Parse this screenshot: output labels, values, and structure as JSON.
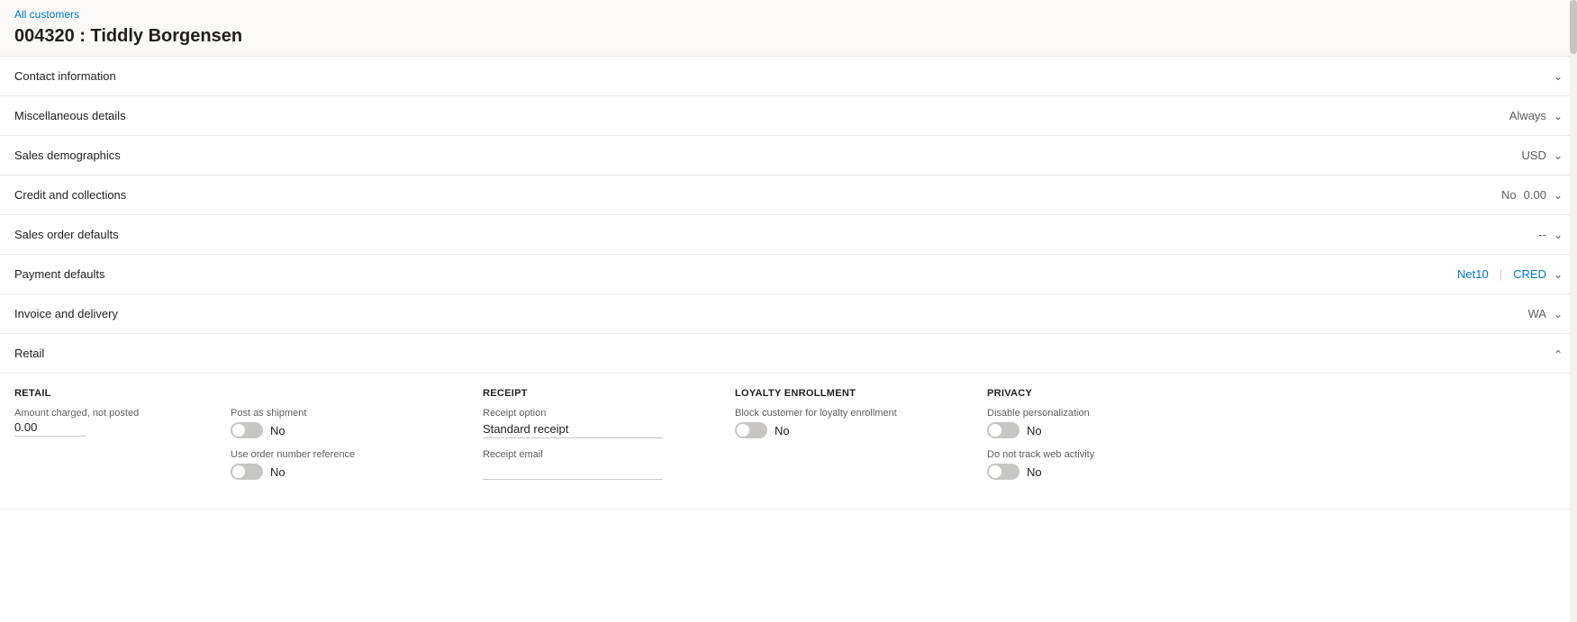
{
  "breadcrumb": {
    "label": "All customers",
    "link_text": "All customers"
  },
  "page": {
    "title": "004320 : Tiddly Borgensen"
  },
  "sections": [
    {
      "id": "contact-information",
      "label": "Contact information",
      "meta": "",
      "expanded": false,
      "chevron": "down"
    },
    {
      "id": "miscellaneous-details",
      "label": "Miscellaneous details",
      "meta": "Always",
      "meta_color": "normal",
      "expanded": false,
      "chevron": "down"
    },
    {
      "id": "sales-demographics",
      "label": "Sales demographics",
      "meta": "USD",
      "meta_color": "blue",
      "expanded": false,
      "chevron": "down"
    },
    {
      "id": "credit-and-collections",
      "label": "Credit and collections",
      "meta_parts": [
        {
          "text": "No",
          "color": "normal"
        },
        {
          "text": "0.00",
          "color": "normal"
        }
      ],
      "expanded": false,
      "chevron": "down"
    },
    {
      "id": "sales-order-defaults",
      "label": "Sales order defaults",
      "meta": "--",
      "meta_color": "normal",
      "expanded": false,
      "chevron": "down"
    },
    {
      "id": "payment-defaults",
      "label": "Payment defaults",
      "meta_parts": [
        {
          "text": "Net10",
          "color": "blue"
        },
        {
          "text": "|",
          "color": "pipe"
        },
        {
          "text": "CRED",
          "color": "blue"
        }
      ],
      "expanded": false,
      "chevron": "down"
    },
    {
      "id": "invoice-and-delivery",
      "label": "Invoice and delivery",
      "meta": "WA",
      "meta_color": "blue",
      "expanded": false,
      "chevron": "down"
    }
  ],
  "retail": {
    "section_label": "Retail",
    "expanded": true,
    "chevron": "up",
    "retail_col": {
      "header": "RETAIL",
      "amount_label": "Amount charged, not posted",
      "amount_value": "0.00"
    },
    "shipment_col": {
      "post_as_shipment_label": "Post as shipment",
      "post_as_shipment_value": "No",
      "use_order_number_label": "Use order number reference",
      "use_order_number_value": "No"
    },
    "receipt_col": {
      "header": "RECEIPT",
      "receipt_option_label": "Receipt option",
      "receipt_option_value": "Standard receipt",
      "receipt_email_label": "Receipt email",
      "receipt_email_value": ""
    },
    "loyalty_col": {
      "header": "LOYALTY ENROLLMENT",
      "block_label": "Block customer for loyalty enrollment",
      "block_value": "No"
    },
    "privacy_col": {
      "header": "PRIVACY",
      "disable_personalization_label": "Disable personalization",
      "disable_personalization_value": "No",
      "do_not_track_label": "Do not track web activity",
      "do_not_track_value": "No"
    }
  }
}
